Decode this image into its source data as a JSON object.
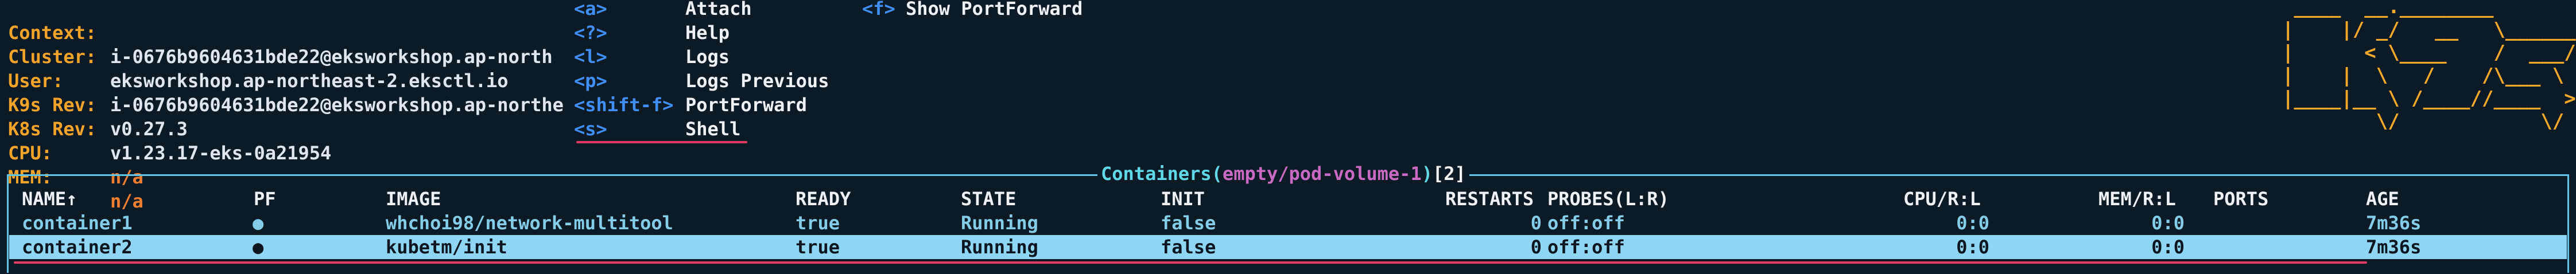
{
  "header": {
    "info": [
      {
        "key": "Context:",
        "value": "i-0676b9604631bde22@eksworkshop.ap-north",
        "warn": false
      },
      {
        "key": "Cluster:",
        "value": "eksworkshop.ap-northeast-2.eksctl.io",
        "warn": false
      },
      {
        "key": "User:",
        "value": "i-0676b9604631bde22@eksworkshop.ap-northe",
        "warn": false
      },
      {
        "key": "K9s Rev:",
        "value": "v0.27.3",
        "warn": false
      },
      {
        "key": "K8s Rev:",
        "value": "v1.23.17-eks-0a21954",
        "warn": false
      },
      {
        "key": "CPU:",
        "value": "n/a",
        "warn": true
      },
      {
        "key": "MEM:",
        "value": "n/a",
        "warn": true
      }
    ],
    "shortcuts_col1": [
      {
        "key": "<a>",
        "label": "Attach"
      },
      {
        "key": "<?>",
        "label": "Help"
      },
      {
        "key": "<l>",
        "label": "Logs"
      },
      {
        "key": "<p>",
        "label": "Logs Previous"
      },
      {
        "key": "<shift-f>",
        "label": "PortForward"
      },
      {
        "key": "<s>",
        "label": "Shell"
      }
    ],
    "shortcuts_col2": [
      {
        "key": "<f>",
        "label": "Show PortForward"
      }
    ],
    "logo_ascii": " ____  __.________\n|    |/ _/   __   \\______\n|      < \\____    /  ___/\n|    |  \\   /    /\\___ \\\n|____|__ \\ /____//____  >\n        \\/            \\/"
  },
  "table": {
    "title_prefix": "Containers",
    "title_open": "(",
    "title_scope": "empty/pod-volume-1",
    "title_close": ")",
    "title_count": "[2]",
    "columns": [
      "NAME↑",
      "PF",
      "IMAGE",
      "READY",
      "STATE",
      "INIT",
      "RESTARTS",
      "PROBES(L:R)",
      "CPU/R:L",
      "MEM/R:L",
      "PORTS",
      "AGE"
    ],
    "rows": [
      {
        "name": "container1",
        "pf": "●",
        "image": "whchoi98/network-multitool",
        "ready": "true",
        "state": "Running",
        "init": "false",
        "restarts": "0",
        "probes": "off:off",
        "cpu": "0:0",
        "mem": "0:0",
        "ports": "",
        "age": "7m36s",
        "selected": false
      },
      {
        "name": "container2",
        "pf": "●",
        "image": "kubetm/init",
        "ready": "true",
        "state": "Running",
        "init": "false",
        "restarts": "0",
        "probes": "off:off",
        "cpu": "0:0",
        "mem": "0:0",
        "ports": "",
        "age": "7m36s",
        "selected": true
      }
    ]
  },
  "colors": {
    "background": "#0c1a26",
    "key_orange": "#f2a32a",
    "shortcut_blue": "#3f8ff6",
    "frame_cyan": "#5fc6ea",
    "title_magenta": "#c96ac2",
    "selection_bg": "#8fd6f4",
    "accent_red": "#e23a62"
  }
}
